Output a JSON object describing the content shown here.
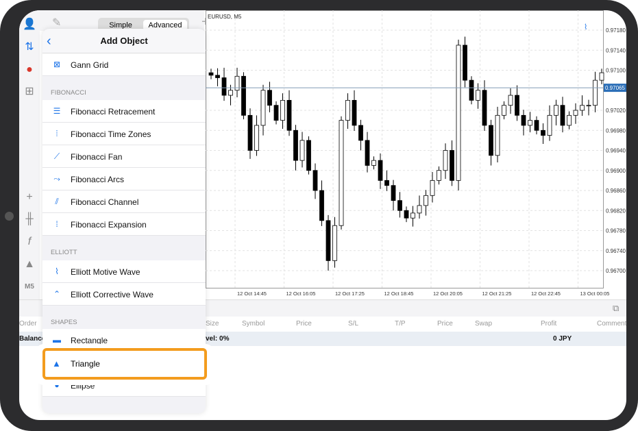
{
  "toolbar": {
    "simple": "Simple",
    "advanced": "Advanced",
    "timeframe": "M5"
  },
  "chart": {
    "symbol": "EURUSD, M5",
    "current_price": "0.97065",
    "price_ticks": [
      "0.97180",
      "0.97140",
      "0.97100",
      "0.97020",
      "0.96980",
      "0.96940",
      "0.96900",
      "0.96860",
      "0.96820",
      "0.96780",
      "0.96740",
      "0.96700"
    ],
    "time_ticks": [
      "12 Oct 14:45",
      "12 Oct 16:05",
      "12 Oct 17:25",
      "12 Oct 18:45",
      "12 Oct 20:05",
      "12 Oct 21:25",
      "12 Oct 22:45",
      "13 Oct 00:05"
    ],
    "closes": [
      0.9709,
      0.97085,
      0.9705,
      0.9706,
      0.97088,
      0.9701,
      0.9694,
      0.9699,
      0.9706,
      0.9703,
      0.97,
      0.9704,
      0.9698,
      0.9692,
      0.9696,
      0.969,
      0.9686,
      0.968,
      0.9672,
      0.9679,
      0.97,
      0.9704,
      0.9699,
      0.9696,
      0.9691,
      0.9692,
      0.9688,
      0.9687,
      0.9684,
      0.9682,
      0.96805,
      0.96815,
      0.9683,
      0.9685,
      0.9688,
      0.969,
      0.9694,
      0.9688,
      0.9715,
      0.9708,
      0.9704,
      0.9706,
      0.9699,
      0.9693,
      0.9701,
      0.9703,
      0.9705,
      0.9701,
      0.9699,
      0.97,
      0.9698,
      0.9697,
      0.9701,
      0.9703,
      0.9699,
      0.9701,
      0.9702,
      0.9703,
      0.9703,
      0.9708,
      0.97095
    ],
    "accent": "#2c6fb8"
  },
  "table": {
    "headers": [
      "Order",
      "Size",
      "Symbol",
      "Price",
      "S/L",
      "T/P",
      "Price",
      "Swap",
      "Profit",
      "Comment"
    ],
    "balance_label": "Balance",
    "level_text": "vel: 0%",
    "profit": "0  JPY"
  },
  "panel": {
    "title": "Add Object",
    "gann": "Gann Grid",
    "sections": {
      "fibonacci": "FIBONACCI",
      "elliott": "ELLIOTT",
      "shapes": "SHAPES"
    },
    "fib": [
      "Fibonacci Retracement",
      "Fibonacci Time Zones",
      "Fibonacci Fan",
      "Fibonacci Arcs",
      "Fibonacci Channel",
      "Fibonacci Expansion"
    ],
    "elliott": [
      "Elliott Motive Wave",
      "Elliott Corrective Wave"
    ],
    "shapes": [
      "Rectangle",
      "Triangle",
      "Ellipse"
    ]
  },
  "highlight_color": "#f39c1e"
}
